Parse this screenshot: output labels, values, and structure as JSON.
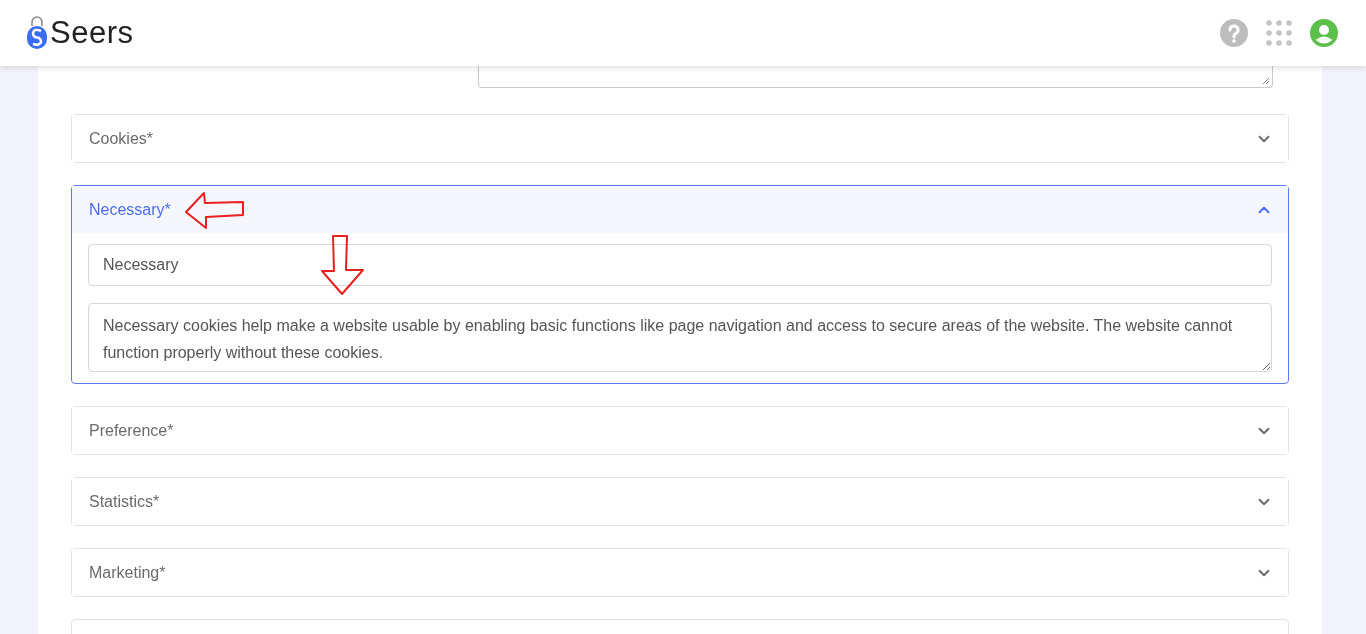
{
  "header": {
    "logo_text": "Seers"
  },
  "sections": [
    {
      "label": "Cookies*",
      "expanded": false
    },
    {
      "label": "Necessary*",
      "expanded": true,
      "name_value": "Necessary",
      "description_value": "Necessary cookies help make a website usable by enabling basic functions like page navigation and access to secure areas of the website. The website cannot function properly without these cookies."
    },
    {
      "label": "Preference*",
      "expanded": false
    },
    {
      "label": "Statistics*",
      "expanded": false
    },
    {
      "label": "Marketing*",
      "expanded": false
    }
  ]
}
